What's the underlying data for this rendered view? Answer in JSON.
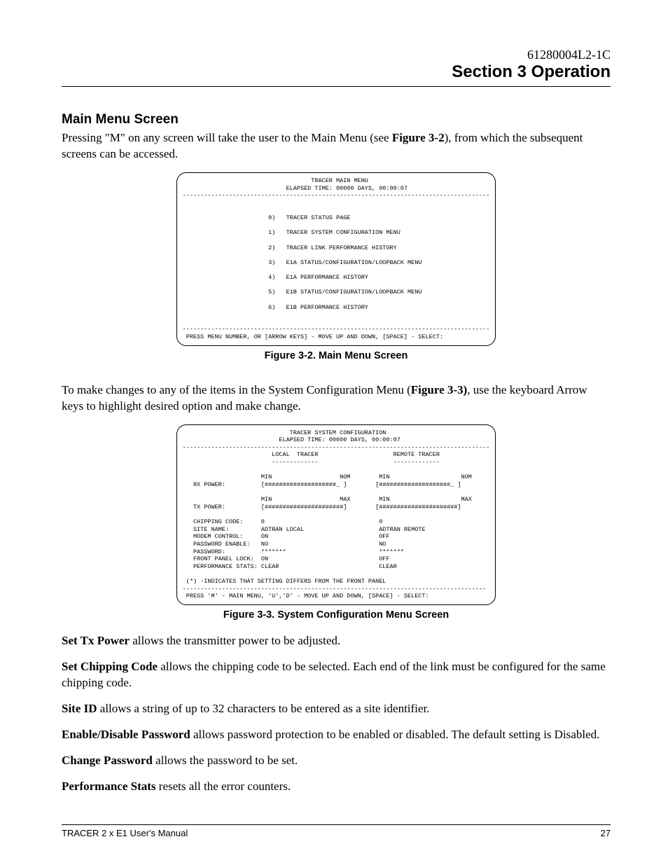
{
  "header": {
    "doc_number": "61280004L2-1C",
    "section_title": "Section 3  Operation"
  },
  "h_main_menu": "Main Menu Screen",
  "p_intro_1": "Pressing \"M\" on any screen will take the user to the Main Menu (see ",
  "p_intro_bold": "Figure 3-2",
  "p_intro_2": "), from which the subsequent screens can be accessed.",
  "fig1": {
    "title": "                                    TRACER MAIN MENU",
    "elapsed": "                             ELAPSED TIME: 00000 DAYS, 00:00:07",
    "rule": "--------------------------------------------------------------------------------------",
    "items": [
      "                        0)   TRACER STATUS PAGE",
      "                        1)   TRACER SYSTEM CONFIGURATION MENU",
      "                        2)   TRACER LINK PERFORMANCE HISTORY",
      "                        3)   E1A STATUS/CONFIGURATION/LOOPBACK MENU",
      "                        4)   E1A PERFORMANCE HISTORY",
      "                        5)   E1B STATUS/CONFIGURATION/LOOPBACK MENU",
      "                        6)   E1B PERFORMANCE HISTORY"
    ],
    "footer": " PRESS MENU NUMBER, OR [ARROW KEYS] - MOVE UP AND DOWN, [SPACE] - SELECT:"
  },
  "caption1": "Figure 3-2.  Main Menu Screen",
  "p_mid_1": "To make changes to any of the items in the System Configuration Menu (",
  "p_mid_bold": "Figure 3-3)",
  "p_mid_2": ", use the keyboard Arrow keys to highlight desired option and make change.",
  "fig2": {
    "title": "                              TRACER SYSTEM CONFIGURATION",
    "elapsed": "                           ELAPSED TIME: 00000 DAYS, 00:00:07",
    "rule": "--------------------------------------------------------------------------------------",
    "hdr1": "                         LOCAL  TRACER                     REMOTE TRACER",
    "hdr2": "                         -------------                     -------------",
    "rx1": "                      MIN                   NOM        MIN                    NOM",
    "rx2": "   RX POWER:          [####################_ ]        [####################_ ]",
    "tx1": "                      MIN                   MAX        MIN                    MAX",
    "tx2": "   TX POWER:          [######################]        [######################]",
    "rows": [
      "   CHIPPING CODE:     0                                0",
      "   SITE NAME:         ADTRAN LOCAL                     ADTRAN REMOTE",
      "   MODEM CONTROL:     ON                               OFF",
      "   PASSWORD ENABLE:   NO                               NO",
      "   PASSWORD:          *******                          *******",
      "   FRONT PANEL LOCK:  ON                               OFF",
      "   PERFORMANCE STATS: CLEAR                            CLEAR"
    ],
    "note": " (*) -INDICATES THAT SETTING DIFFERS FROM THE FRONT PANEL",
    "rule2": "-------------------------------------------------------------------------------------",
    "footer": " PRESS 'M' - MAIN MENU, 'U','D' - MOVE UP AND DOWN, [SPACE] - SELECT:"
  },
  "caption2": "Figure 3-3.  System Configuration Menu Screen",
  "para_tx_b": "Set Tx Power",
  "para_tx_t": " allows the transmitter power to be adjusted.",
  "para_chip_b": "Set Chipping Code",
  "para_chip_t": " allows the chipping code to be selected.  Each end of the link must be configured for the same chipping code.",
  "para_site_b": "Site ID",
  "para_site_t": " allows a string of up to 32 characters to be entered as a site identifier.",
  "para_pw_b": "Enable/Disable Password",
  "para_pw_t": " allows password protection to be enabled or disabled.  The default setting is Disabled.",
  "para_cpw_b": "Change Password",
  "para_cpw_t": " allows the password to be set.",
  "para_perf_b": "Performance Stats",
  "para_perf_t": " resets all the error counters.",
  "footer": {
    "left": "TRACER 2 x E1 User's Manual",
    "right": "27"
  }
}
